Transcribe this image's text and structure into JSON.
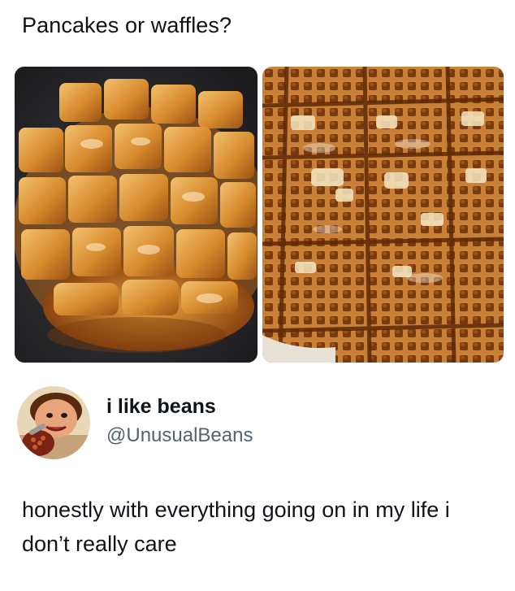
{
  "header": {
    "question": "Pancakes or waffles?"
  },
  "images": {
    "left": {
      "subject": "pancake-photo"
    },
    "right": {
      "subject": "waffles-photo"
    }
  },
  "author": {
    "display_name": "i like beans",
    "handle": "@UnusualBeans"
  },
  "post": {
    "text": "honestly with everything going on in my life i don’t really care"
  },
  "colors": {
    "text_primary": "#0f1419",
    "text_secondary": "#536471",
    "background": "#ffffff"
  }
}
